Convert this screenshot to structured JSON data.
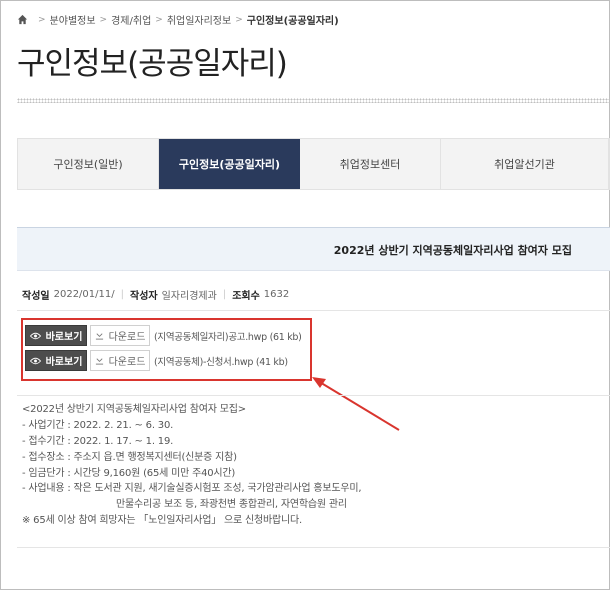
{
  "breadcrumb": {
    "items": [
      "분야별정보",
      "경제/취업",
      "취업일자리정보"
    ],
    "current": "구인정보(공공일자리)"
  },
  "page_title": "구인정보(공공일자리)",
  "tabs": [
    {
      "label": "구인정보(일반)",
      "active": false
    },
    {
      "label": "구인정보(공공일자리)",
      "active": true
    },
    {
      "label": "취업정보센터",
      "active": false
    },
    {
      "label": "취업알선기관",
      "active": false
    }
  ],
  "article": {
    "title": "2022년 상반기 지역공동체일자리사업 참여자 모집",
    "meta": {
      "date_label": "작성일",
      "date": "2022/01/11/",
      "author_label": "작성자",
      "author": "일자리경제과",
      "views_label": "조회수",
      "views": "1632"
    }
  },
  "attachments": {
    "view_label": "바로보기",
    "download_label": "다운로드",
    "files": [
      "(지역공동체일자리)공고.hwp (61 kb)",
      "(지역공동체)-신청서.hwp (41 kb)"
    ]
  },
  "body_lines": [
    "<2022년 상반기 지역공동체일자리사업 참여자 모집>",
    "- 사업기간 : 2022. 2. 21. ~ 6. 30.",
    "- 접수기간 : 2022. 1. 17. ~ 1. 19.",
    "- 접수장소 : 주소지 읍.면 행정복지센터(신분증 지참)",
    "- 임금단가 : 시간당 9,160원 (65세 미만 주40시간)",
    "- 사업내용 : 작은 도서관 지원, 새기술실증시험포 조성, 국가암관리사업 홍보도우미,",
    "만물수리공 보조 등, 좌광천변 종합관리, 자연학습원 관리",
    "※ 65세 이상 참여 희망자는 「노인일자리사업」 으로 신청바랍니다."
  ],
  "colors": {
    "active_tab": "#2a3a5c",
    "highlight_box": "#d9352e",
    "article_head_bg": "#eef3f9",
    "view_button": "#4d4d4d"
  },
  "icons": {
    "home": "home-icon",
    "view": "eye-icon",
    "download": "download-icon",
    "annotation": "red-arrow"
  }
}
